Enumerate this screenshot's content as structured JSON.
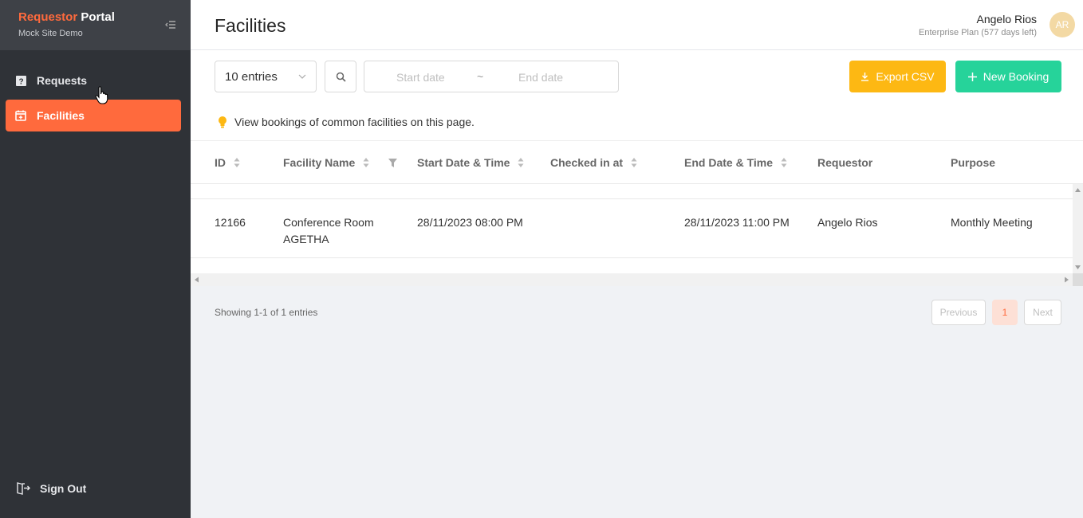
{
  "brand": {
    "title_accent": "Requestor",
    "title_rest": "Portal",
    "subtitle": "Mock Site Demo"
  },
  "nav": [
    {
      "label": "Requests",
      "icon": "question-square-icon",
      "active": false
    },
    {
      "label": "Facilities",
      "icon": "calendar-plus-icon",
      "active": true
    }
  ],
  "signout": {
    "label": "Sign Out",
    "icon": "sign-out-icon"
  },
  "header": {
    "title": "Facilities"
  },
  "user": {
    "name": "Angelo Rios",
    "plan": "Enterprise Plan (577 days left)",
    "initials": "AR"
  },
  "toolbar": {
    "entries_value": "10 entries",
    "start_placeholder": "Start date",
    "range_separator": "~",
    "end_placeholder": "End date",
    "export_label": "Export CSV",
    "new_label": "New Booking"
  },
  "info_text": "View bookings of common facilities on this page.",
  "table": {
    "columns": [
      "ID",
      "Facility Name",
      "Start Date & Time",
      "Checked in at",
      "End Date & Time",
      "Requestor",
      "Purpose"
    ],
    "rows": [
      {
        "id": "12166",
        "facility_line1": "Conference Room",
        "facility_line2": "AGETHA",
        "start": "28/11/2023 08:00 PM",
        "checked_in": "",
        "end": "28/11/2023 11:00 PM",
        "requestor": "Angelo Rios",
        "purpose": "Monthly Meeting"
      }
    ]
  },
  "footer": {
    "showing": "Showing 1-1 of 1 entries",
    "previous": "Previous",
    "page": "1",
    "next": "Next"
  },
  "colors": {
    "accent": "#ff6a3d",
    "export": "#fdb813",
    "new_booking": "#26d39a",
    "sidebar": "#2f3237"
  }
}
